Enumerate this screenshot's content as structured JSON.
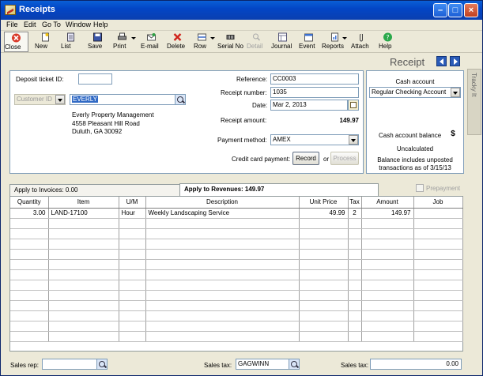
{
  "window": {
    "title": "Receipts"
  },
  "menu": [
    {
      "label": "File",
      "acc": "F"
    },
    {
      "label": "Edit",
      "acc": "E"
    },
    {
      "label": "Go To",
      "acc": "G"
    },
    {
      "label": "Window",
      "acc": "W"
    },
    {
      "label": "Help",
      "acc": "H"
    }
  ],
  "toolbar": {
    "close": "Close",
    "new": "New",
    "list": "List",
    "save": "Save",
    "print": "Print",
    "email": "E-mail",
    "delete": "Delete",
    "row": "Row",
    "serial": "Serial No",
    "detail": "Detail",
    "journal": "Journal",
    "event": "Event",
    "reports": "Reports",
    "attach": "Attach",
    "help": "Help"
  },
  "header": {
    "receipt_label": "Receipt"
  },
  "sidetab": {
    "label": "Tracky It"
  },
  "form": {
    "deposit_ticket_label": "Deposit ticket ID:",
    "deposit_ticket_value": "",
    "customer_id_placeholder": "Customer ID",
    "customer_id_value": "EVERLY",
    "customer_address": [
      "Everly Property Management",
      "4558 Pleasant Hill Road",
      "Duluth, GA 30092"
    ],
    "reference_label": "Reference:",
    "reference_value": "CC0003",
    "receipt_number_label": "Receipt number:",
    "receipt_number_value": "1035",
    "date_label": "Date:",
    "date_value": "Mar 2, 2013",
    "receipt_amount_label": "Receipt amount:",
    "receipt_amount_value": "149.97",
    "payment_method_label": "Payment method:",
    "payment_method_value": "AMEX",
    "cc_payment_label": "Credit card payment:",
    "record_button": "Record",
    "or_text": "or",
    "process_button": "Process"
  },
  "cash": {
    "account_label": "Cash account",
    "account_value": "Regular Checking Account",
    "balance_label": "Cash account balance",
    "balance_value": "Uncalculated",
    "note": [
      "Balance includes unposted",
      "transactions as of 3/15/13"
    ]
  },
  "tabs": {
    "invoices": "Apply to Invoices: 0.00",
    "revenues": "Apply to Revenues: 149.97",
    "prepayment": "Prepayment"
  },
  "grid": {
    "columns": [
      "Quantity",
      "Item",
      "U/M",
      "Description",
      "Unit Price",
      "Tax",
      "Amount",
      "Job"
    ],
    "rows": [
      [
        "3.00",
        "LAND-17100",
        "Hour",
        "Weekly Landscaping Service",
        "49.99",
        "2",
        "149.97",
        ""
      ]
    ],
    "empty_rows": 12
  },
  "footer": {
    "sales_rep_label": "Sales rep:",
    "sales_rep_value": "",
    "sales_tax_label": "Sales tax:",
    "sales_tax_code": "GAGWINN",
    "sales_tax_label2": "Sales tax:",
    "sales_tax_amount": "0.00"
  }
}
